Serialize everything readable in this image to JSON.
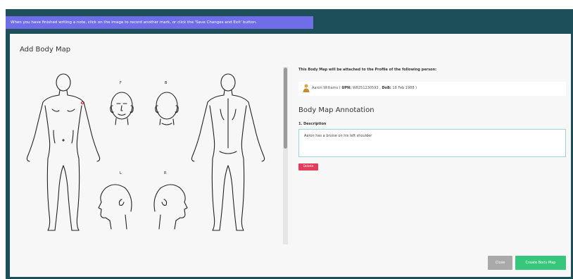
{
  "banner": {
    "message": "When you have finished writing a note, click on the image to record another mark, or click the 'Save Changes and Exit' button."
  },
  "page": {
    "title": "Add Body Map"
  },
  "body_map": {
    "labels": {
      "front": "F",
      "back": "B",
      "left": "L",
      "right": "R"
    }
  },
  "profile": {
    "attach_text": "This Body Map will be attached to the Profile of the following person:",
    "person_name": "Aaron Williams",
    "upn_label": "UPN:",
    "upn_value": "W8251230593",
    "dob_label": "DoB:",
    "dob_value": "18 Feb 1988",
    "icon": "person-icon"
  },
  "annotation": {
    "title": "Body Map Annotation",
    "description_label": "1. Description",
    "description_value": "Aaron has a bruise on his left shoulder",
    "delete_label": "Delete"
  },
  "actions": {
    "close_label": "Close",
    "create_label": "Create Body Map"
  },
  "colors": {
    "frame": "#1d4f5a",
    "banner": "#6f6ee8",
    "delete": "#e33d5b",
    "create": "#36c77c",
    "close": "#a9a9a9"
  }
}
